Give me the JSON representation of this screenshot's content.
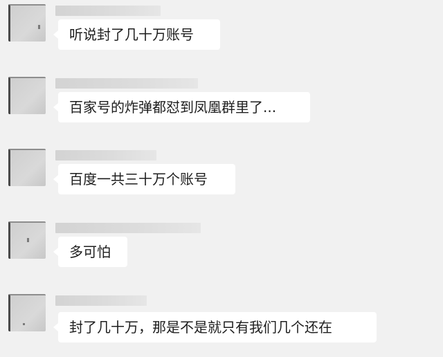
{
  "chat": {
    "messages": [
      {
        "text": "听说封了几十万账号"
      },
      {
        "text": "百家号的炸弹都怼到凤凰群里了..."
      },
      {
        "text": "百度一共三十万个账号"
      },
      {
        "text": "多可怕"
      },
      {
        "text": "封了几十万，那是不是就只有我们几个还在"
      }
    ]
  }
}
